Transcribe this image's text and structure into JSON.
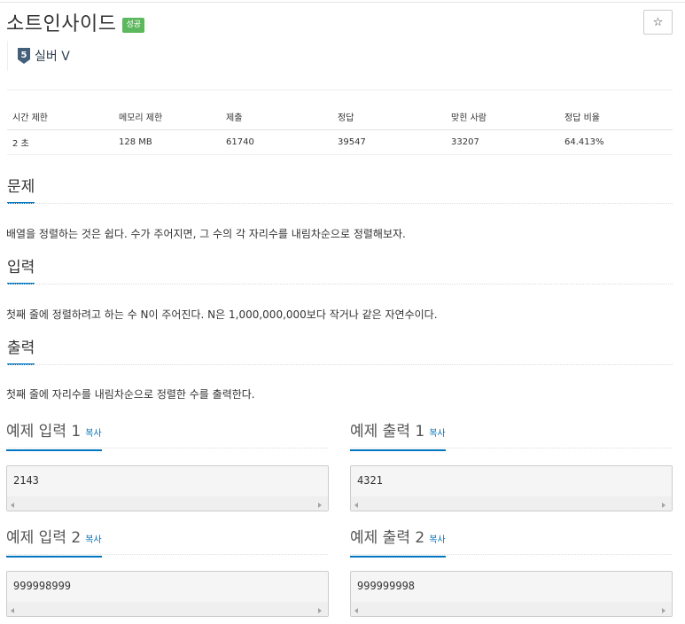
{
  "problem": {
    "title": "소트인사이드",
    "status_badge": "성공",
    "bookmark_icon": "star-icon",
    "tier": {
      "icon": "silver-5-tier-icon",
      "number": "5",
      "label": "실버 V",
      "color": "#435f7a"
    }
  },
  "info_table": {
    "headers": [
      "시간 제한",
      "메모리 제한",
      "제출",
      "정답",
      "맞힌 사람",
      "정답 비율"
    ],
    "row": [
      "2 초",
      "128 MB",
      "61740",
      "39547",
      "33207",
      "64.413%"
    ]
  },
  "sections": {
    "description": {
      "title": "문제",
      "text": "배열을 정렬하는 것은 쉽다. 수가 주어지면, 그 수의 각 자리수를 내림차순으로 정렬해보자."
    },
    "input": {
      "title": "입력",
      "text": "첫째 줄에 정렬하려고 하는 수 N이 주어진다. N은 1,000,000,000보다 작거나 같은 자연수이다."
    },
    "output": {
      "title": "출력",
      "text": "첫째 줄에 자리수를 내림차순으로 정렬한 수를 출력한다."
    }
  },
  "samples": [
    {
      "input_title": "예제 입력 1",
      "output_title": "예제 출력 1",
      "copy_label": "복사",
      "input": "2143",
      "output": "4321"
    },
    {
      "input_title": "예제 입력 2",
      "output_title": "예제 출력 2",
      "copy_label": "복사",
      "input": "999998999",
      "output": "999999998"
    }
  ],
  "colors": {
    "accent": "#0076c0",
    "success": "#5cb85c"
  }
}
